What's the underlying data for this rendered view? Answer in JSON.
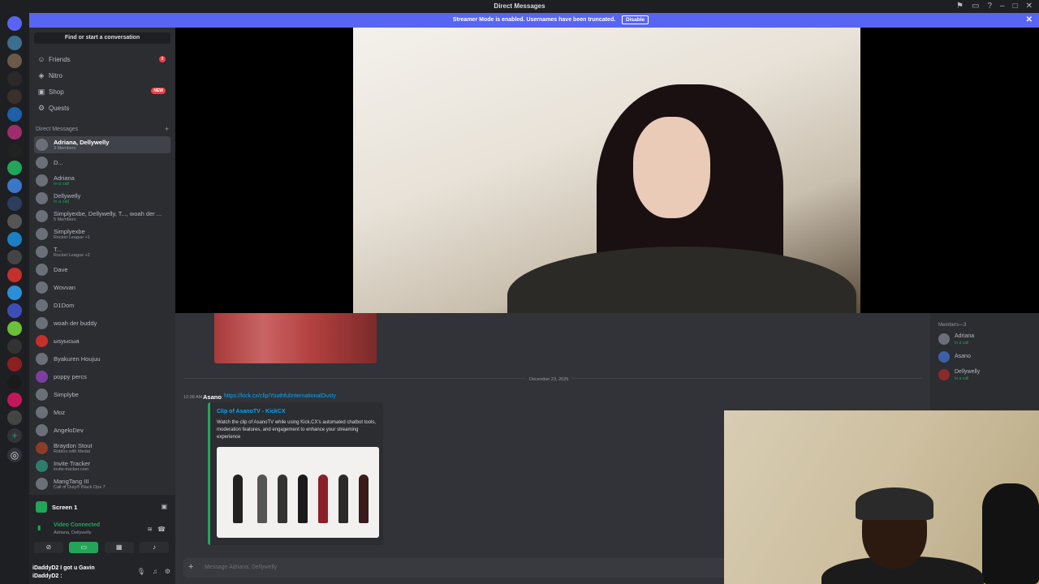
{
  "titlebar": {
    "title": "Direct Messages"
  },
  "banner": {
    "message": "Streamer Mode is enabled. Usernames have been truncated.",
    "button": "Disable"
  },
  "sidebar": {
    "search_label": "Find or start a conversation",
    "nav": [
      {
        "label": "Friends",
        "icon": "friends-icon",
        "badge": "8"
      },
      {
        "label": "Nitro",
        "icon": "nitro-icon"
      },
      {
        "label": "Shop",
        "icon": "shop-icon",
        "badge_new": "NEW"
      },
      {
        "label": "Quests",
        "icon": "quests-icon"
      }
    ],
    "dm_header": "Direct Messages",
    "dms": [
      {
        "name": "Adriana, Dellywelly",
        "status": "3 Members"
      },
      {
        "name": "D...",
        "status": ""
      },
      {
        "name": "Adriana",
        "status": "In a call"
      },
      {
        "name": "Dellywelly",
        "status": "In a call"
      },
      {
        "name": "Simplyexbe, Dellywelly, T..., woah der ...",
        "status": "5 Members"
      },
      {
        "name": "Simplyexbe",
        "status": "Rocket League +1"
      },
      {
        "name": "T...",
        "status": "Rocket League +2"
      },
      {
        "name": "Dave",
        "status": ""
      },
      {
        "name": "Wovvan",
        "status": ""
      },
      {
        "name": "D1Dom",
        "status": ""
      },
      {
        "name": "woah der buddy",
        "status": ""
      },
      {
        "name": "ыsyысыa",
        "status": ""
      },
      {
        "name": "Byakuren Houjuu",
        "status": ""
      },
      {
        "name": "poppy percs",
        "status": ""
      },
      {
        "name": "Simplybe",
        "status": ""
      },
      {
        "name": "Moz",
        "status": ""
      },
      {
        "name": "AngeloDev",
        "status": ""
      },
      {
        "name": "Braydon Stout",
        "status": "Roblox with Medal"
      },
      {
        "name": "Invite Tracker",
        "status": "invite-tracker.com"
      },
      {
        "name": "MangTang III",
        "status": "Call of Duty® Black Ops 7"
      }
    ],
    "voice": {
      "screen_label": "Screen 1",
      "connected": "Video Connected",
      "channel": "Adriana, Dellywelly"
    },
    "user": {
      "line1": "iDaddyD2 I got u Gavin",
      "line2": "iDaddyD2 :"
    }
  },
  "chat": {
    "date_divider": "December 23, 2025",
    "message": {
      "time": "12:38 AM",
      "author": "Asano",
      "link": "https://kick.cx/clip/YouthfulInternationalDusty"
    },
    "embed": {
      "title": "Clip of AsanoTV - KickCX",
      "description": "Watch the clip of AsanoTV while using Kick.CX's automated chatbot tools, moderation features, and engagement to enhance your streaming experience"
    },
    "composer_placeholder": "Message Adriana, Dellywelly"
  },
  "members": {
    "header": "Members—3",
    "list": [
      {
        "name": "Adriana",
        "status": "In a call"
      },
      {
        "name": "Asano",
        "status": ""
      },
      {
        "name": "Dellywelly",
        "status": "In a call"
      }
    ]
  }
}
